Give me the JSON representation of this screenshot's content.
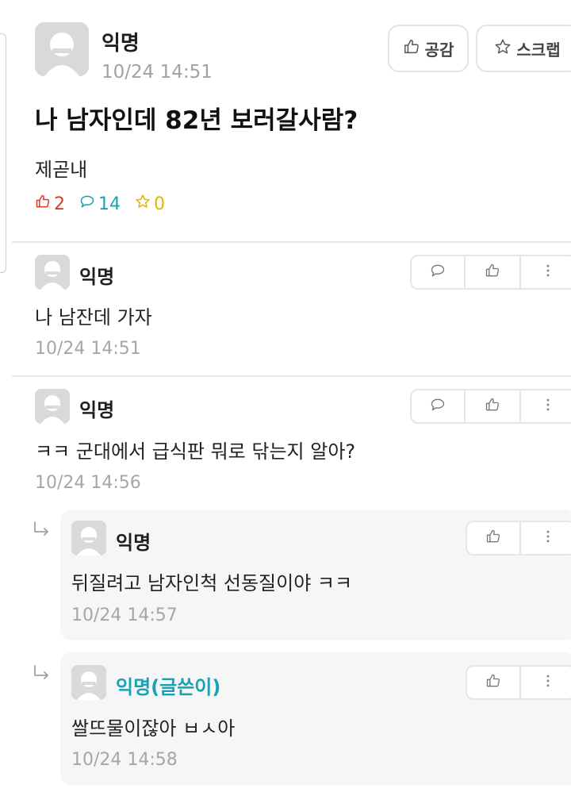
{
  "post": {
    "author": "익명",
    "time": "10/24 14:51",
    "like_button": "공감",
    "scrap_button": "스크랩",
    "title": "나 남자인데 82년 보러갈사람?",
    "body": "제곧내",
    "likes": "2",
    "comments": "14",
    "scraps": "0"
  },
  "comments": [
    {
      "author": "익명",
      "text": "나 남잔데 가자",
      "time": "10/24 14:51"
    },
    {
      "author": "익명",
      "text": "ㅋㅋ 군대에서 급식판 뭐로 닦는지 알아?",
      "time": "10/24 14:56"
    }
  ],
  "replies": [
    {
      "author": "익명",
      "text": "뒤질려고 남자인척 선동질이야 ㅋㅋ",
      "time": "10/24 14:57"
    },
    {
      "author": "익명(글쓴이)",
      "text": "쌀뜨물이잖아 ㅂㅅ아",
      "time": "10/24 14:58"
    }
  ],
  "colors": {
    "accent": "#17a2b5",
    "like": "#d83a2b",
    "scrap": "#e5b400"
  },
  "icons": {
    "like": "thumbs-up-icon",
    "comment": "speech-bubble-icon",
    "scrap": "star-icon",
    "more": "more-vertical-icon",
    "reply": "reply-arrow-icon"
  }
}
